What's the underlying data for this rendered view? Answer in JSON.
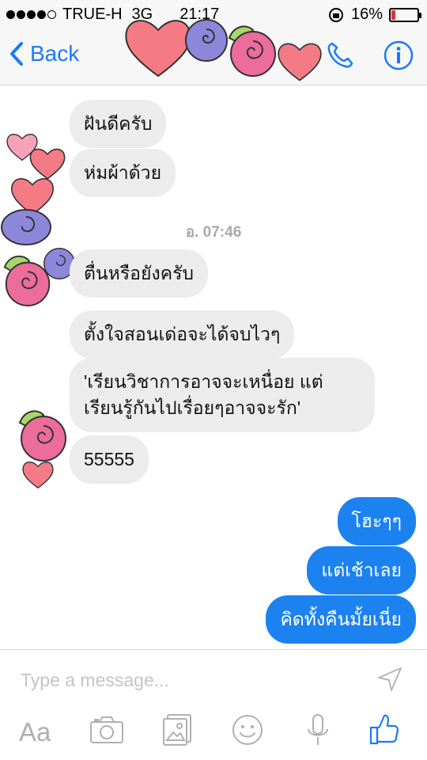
{
  "status_bar": {
    "carrier": "TRUE-H",
    "network": "3G",
    "time": "21:17",
    "battery_percent": "16%",
    "battery_level": 0.16,
    "signal_bars": 4
  },
  "nav": {
    "back_label": "Back",
    "call_icon": "phone-icon",
    "info_icon": "info-icon"
  },
  "messages": [
    {
      "side": "in",
      "text": "ฝันดีครับ"
    },
    {
      "side": "in",
      "text": "ห่มผ้าด้วย"
    },
    {
      "side": "timestamp",
      "text": "อ. 07:46"
    },
    {
      "side": "in",
      "text": "ตื่นหรือยังครับ"
    },
    {
      "side": "in",
      "text": "ตั้งใจสอนเด่อจะได้จบไวๆ"
    },
    {
      "side": "in",
      "text": "'เรียนวิชาการอาจจะเหนื่อย แต่เรียนรู้กันไปเรื่อยๆอาจจะรัก'"
    },
    {
      "side": "in",
      "text": "55555"
    },
    {
      "side": "out",
      "text": "โฮะๆๆ"
    },
    {
      "side": "out",
      "text": "แต่เช้าเลย"
    },
    {
      "side": "out",
      "text": "คิดทั้งคืนมั้ยเนี่ย"
    }
  ],
  "composer": {
    "placeholder": "Type a message...",
    "toolbar": {
      "aa_label": "Aa",
      "icons": [
        "camera-icon",
        "gallery-icon",
        "emoji-icon",
        "microphone-icon",
        "thumbs-up-icon"
      ]
    }
  },
  "colors": {
    "accent": "#1a7cf5",
    "incoming_bubble": "#ececed",
    "outgoing_bubble": "#1b82f0",
    "battery_low": "#e0323a"
  },
  "stickers": [
    "heart-sticker",
    "rose-sticker"
  ]
}
